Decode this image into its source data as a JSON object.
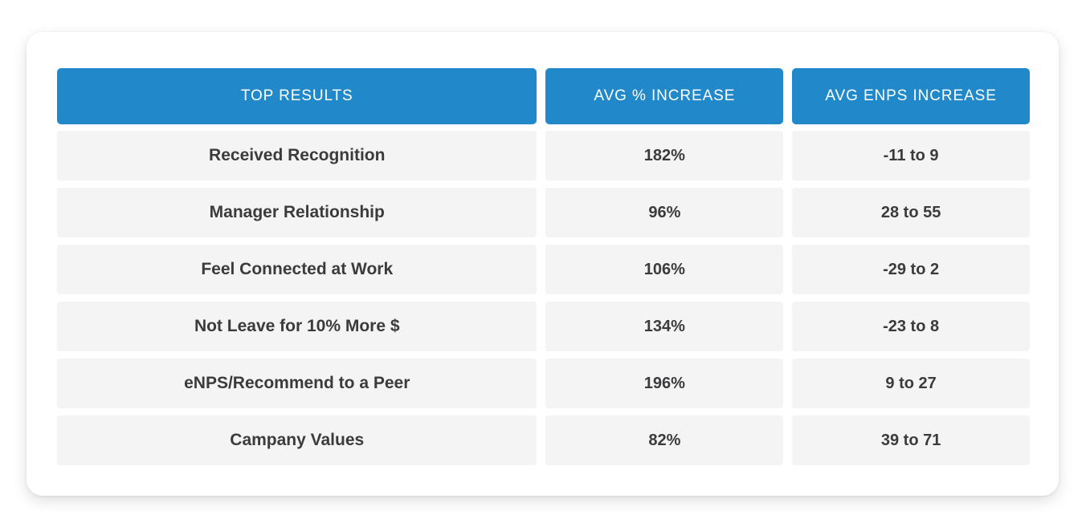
{
  "table": {
    "columns": [
      {
        "key": "label",
        "header": "TOP RESULTS"
      },
      {
        "key": "pct",
        "header": "AVG % INCREASE"
      },
      {
        "key": "enps",
        "header": "AVG eNPS INCREASE"
      }
    ],
    "rows": [
      {
        "label": "Received Recognition",
        "pct": "182%",
        "enps": "-11 to 9"
      },
      {
        "label": "Manager Relationship",
        "pct": "96%",
        "enps": "28 to 55"
      },
      {
        "label": "Feel Connected at Work",
        "pct": "106%",
        "enps": "-29 to 2"
      },
      {
        "label": "Not Leave for 10% More $",
        "pct": "134%",
        "enps": "-23 to 8"
      },
      {
        "label": "eNPS/Recommend to a Peer",
        "pct": "196%",
        "enps": "9 to 27"
      },
      {
        "label": "Campany Values",
        "pct": "82%",
        "enps": "39 to 71"
      }
    ]
  },
  "colors": {
    "header_background": "#2189c9",
    "header_text": "#ffffff",
    "cell_background": "#f4f4f4",
    "cell_text": "#3b3b3d",
    "card_background": "#ffffff",
    "page_background": "#ffffff"
  }
}
